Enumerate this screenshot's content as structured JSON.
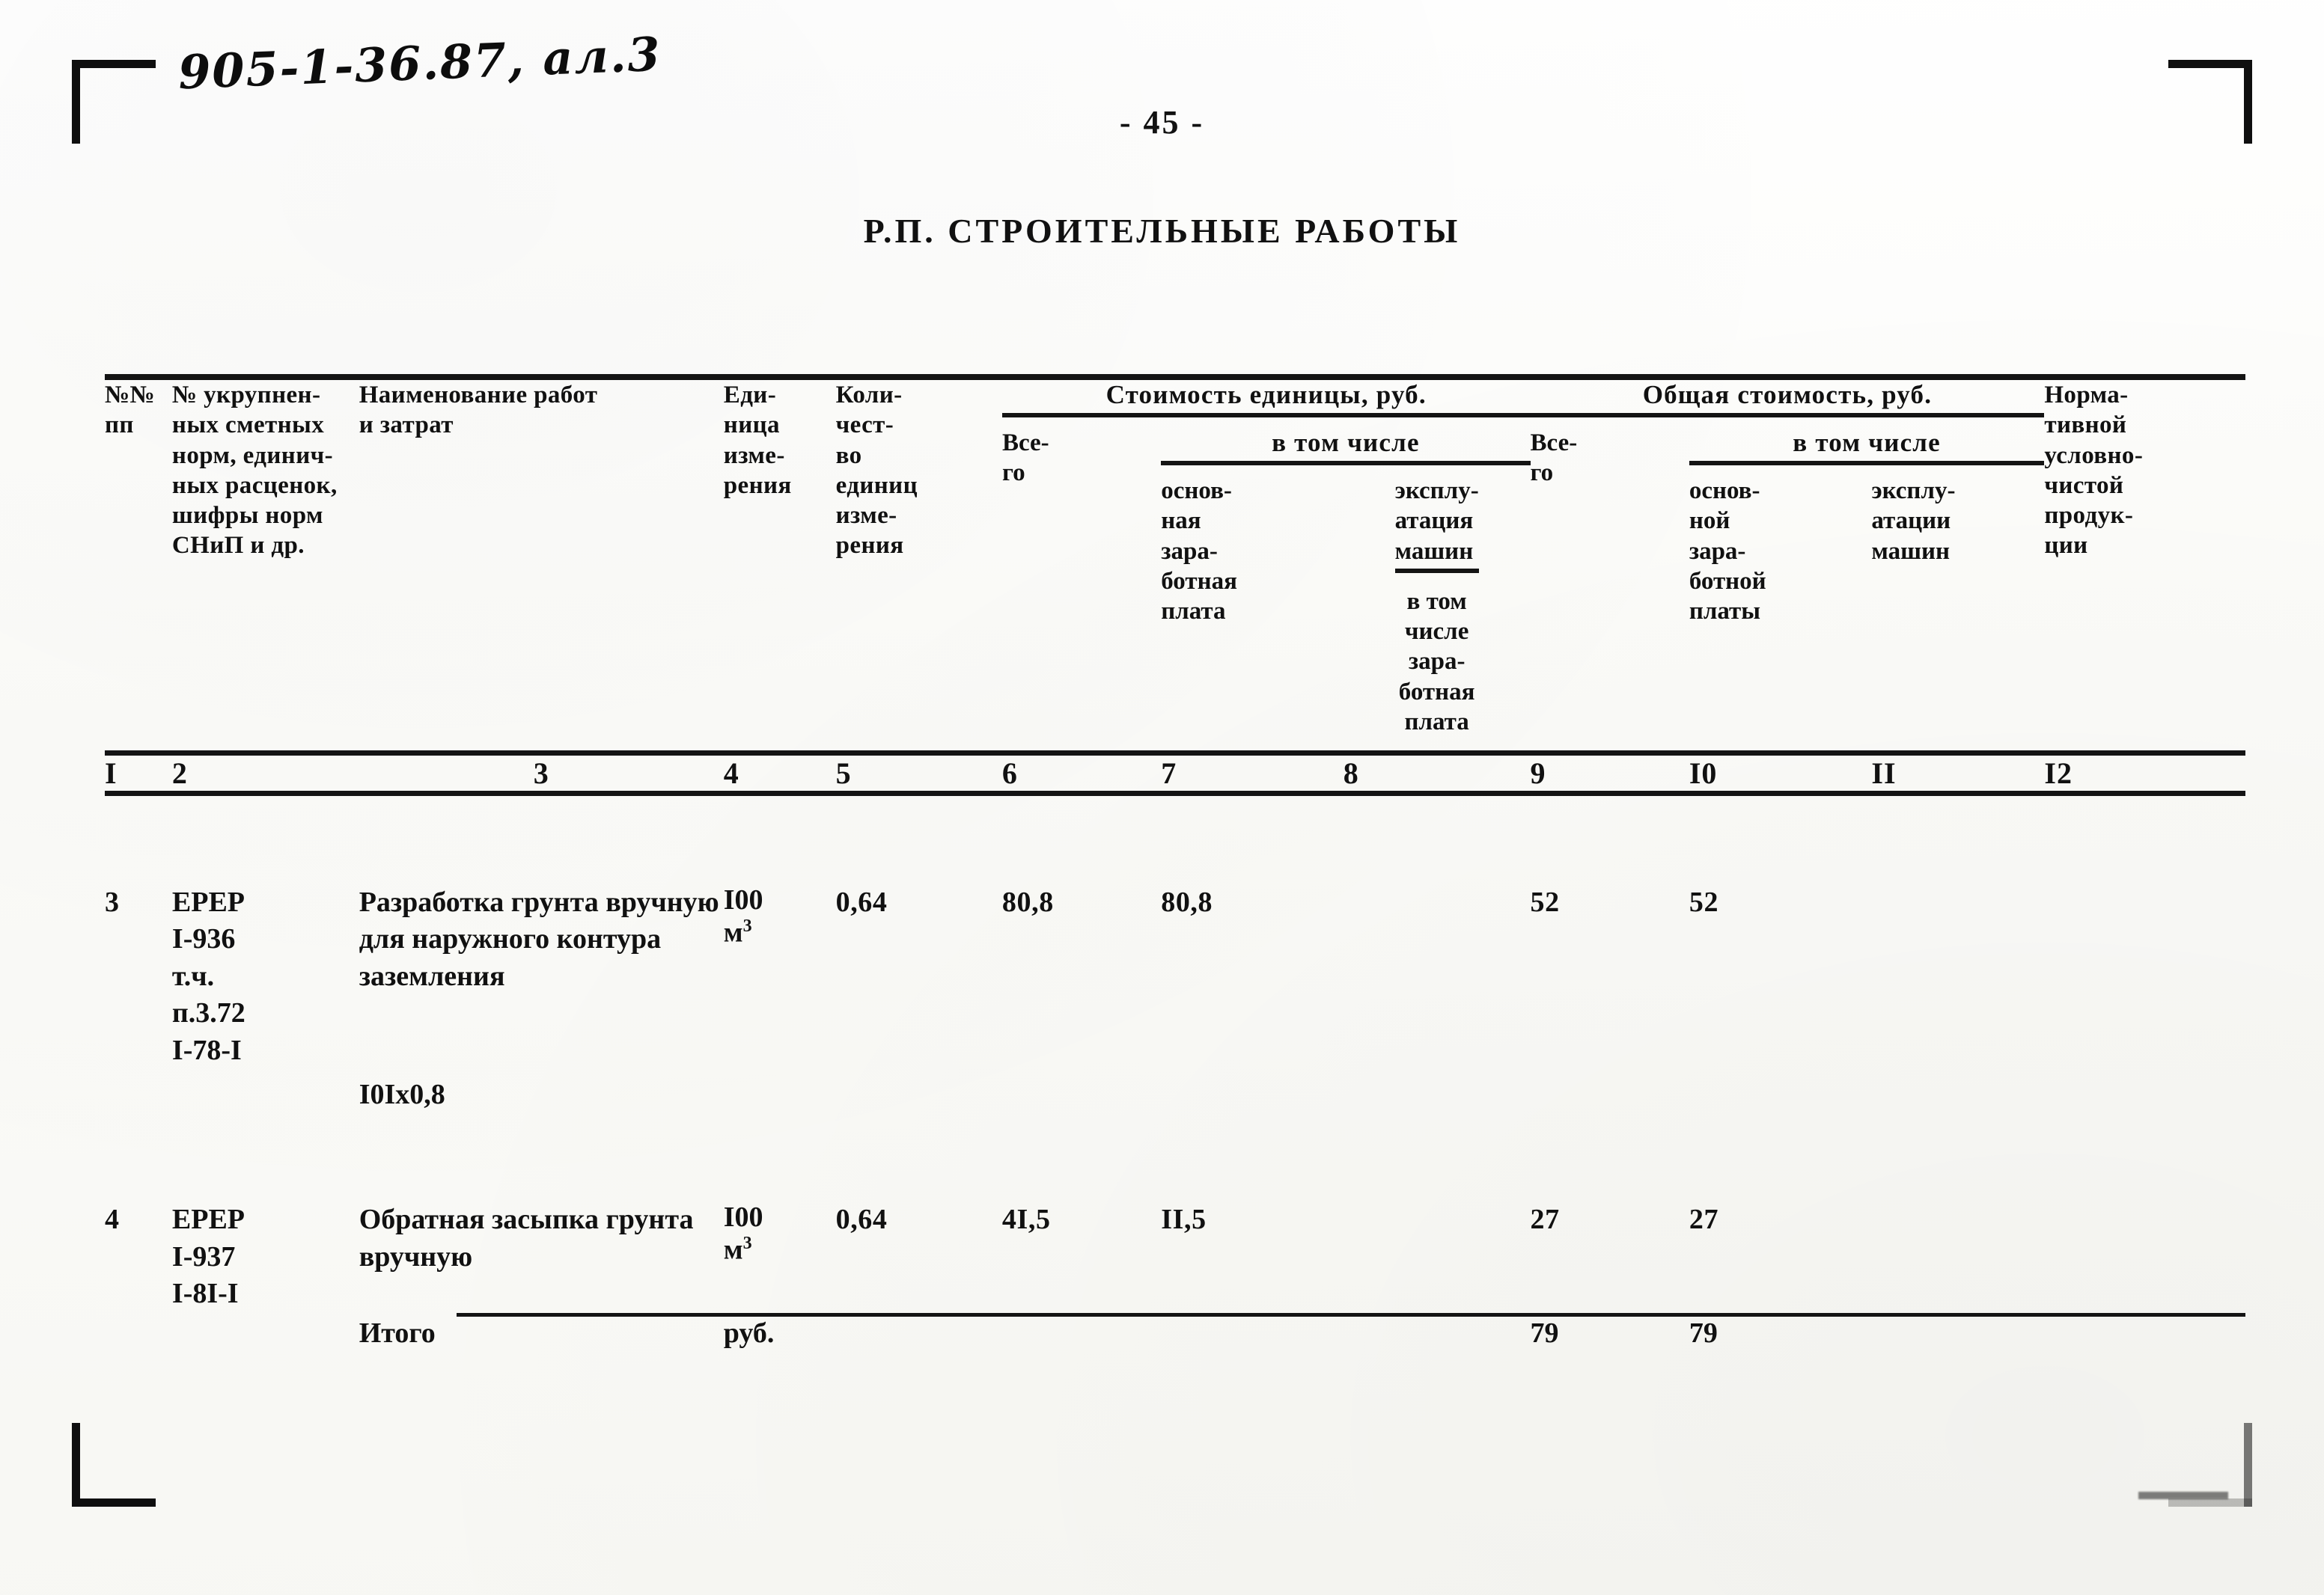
{
  "annotation": "905-1-36.87, ал.3",
  "page_number": "- 45 -",
  "title": "Р.П. СТРОИТЕЛЬНЫЕ РАБОТЫ",
  "table": {
    "headers": {
      "col1": "№№\nпп",
      "col2": "№ укрупнен-\nных сметных\nнорм, единич-\nных расценок,\nшифры норм\nСНиП и др.",
      "col3": "Наименование работ\nи затрат",
      "col4": "Еди-\nница\nизме-\nрения",
      "col5": "Коли-\nчест-\nво\nединиц\nизме-\nрения",
      "span_unit_cost": "Стоимость единицы, руб.",
      "span_total_cost": "Общая стоимость, руб.",
      "in_which_1": "в том числе",
      "in_which_2": "в том числе",
      "col6": "Все-\nго",
      "col7": "основ-\nная\nзара-\nботная\nплата",
      "col8": "эксплу-\nатация\nмашин",
      "col8_note": "в том\nчисле\nзара-\nботная\nплата",
      "col9": "Все-\nго",
      "col10": "основ-\nной\nзара-\nботной\nплаты",
      "col11": "эксплу-\nатации\nмашин",
      "col12": "Норма-\nтивной\nусловно-\nчистой\nпродук-\nции"
    },
    "column_numbers": [
      "I",
      "2",
      "3",
      "4",
      "5",
      "6",
      "7",
      "8",
      "9",
      "I0",
      "II",
      "I2"
    ],
    "rows": [
      {
        "no": "3",
        "norm_code": "ЕРЕР\nI-936\nт.ч.\nп.3.72\nI-78-I",
        "description": "Разработка грунта вручную\nдля наружного контура\nзаземления",
        "calc": "I0Iх0,8",
        "unit_value": "I00",
        "unit_sup": "м",
        "unit_exp": "3",
        "quantity": "0,64",
        "unit_total": "80,8",
        "unit_basic_wage": "80,8",
        "unit_machines": "",
        "unit_machines_wage": "",
        "total": "52",
        "total_basic_wage": "52",
        "total_machines": "",
        "normative": ""
      },
      {
        "no": "4",
        "norm_code": "ЕРЕР\nI-937\nI-8I-I",
        "description": "Обратная засыпка грунта\nвручную",
        "calc": "",
        "unit_value": "I00",
        "unit_sup": "м",
        "unit_exp": "3",
        "quantity": "0,64",
        "unit_total": "4I,5",
        "unit_basic_wage": "II,5",
        "unit_machines": "",
        "unit_machines_wage": "",
        "total": "27",
        "total_basic_wage": "27",
        "total_machines": "",
        "normative": ""
      }
    ],
    "totals": {
      "label": "Итого",
      "unit": "руб.",
      "total": "79",
      "total_basic_wage": "79"
    }
  }
}
